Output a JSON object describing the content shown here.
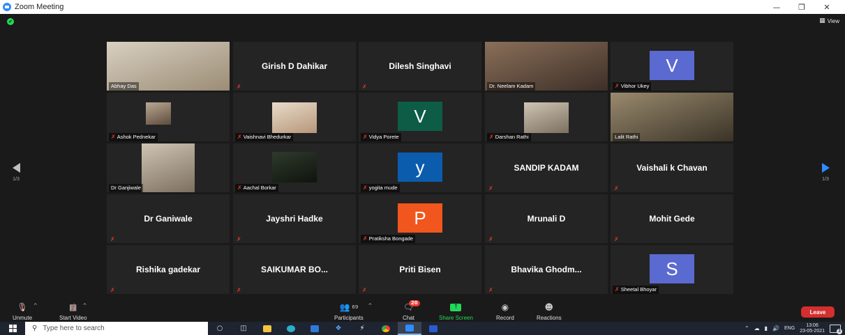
{
  "window": {
    "title": "Zoom Meeting",
    "minimize": "—",
    "restore": "❐",
    "close": "✕"
  },
  "topbar": {
    "view_label": "View",
    "view_icon": "grid-icon",
    "shield": "✔"
  },
  "pagination": {
    "left_page": "1/3",
    "right_page": "1/3"
  },
  "tiles": [
    {
      "name": "Abhay Das",
      "video": true
    },
    {
      "name": "Girish D Dahikar",
      "muted": true
    },
    {
      "name": "Dilesh Singhavi",
      "muted": true
    },
    {
      "name": "Dr. Neelam Kadam",
      "video": true,
      "active_speaker": true
    },
    {
      "name": "Vibhor Ukey",
      "initial": "V",
      "color": "#5a6ad0",
      "muted": true
    },
    {
      "name": "Ashok Pednekar",
      "video": true,
      "muted": true
    },
    {
      "name": "Vaishnavi Bhedurkar",
      "video": true,
      "muted": true
    },
    {
      "name": "Vidya Porete",
      "initial": "V",
      "color": "#0d5c46",
      "muted": true
    },
    {
      "name": "Darshan Rathi",
      "video": true,
      "muted": true
    },
    {
      "name": "Lalit Rathi",
      "video": true
    },
    {
      "name": "Dr Ganjiwale",
      "video": true
    },
    {
      "name": "Aachal Borkar",
      "video": true,
      "muted": true
    },
    {
      "name": "yogita mude",
      "initial": "y",
      "color": "#0b5cad",
      "muted": true
    },
    {
      "name": "SANDIP KADAM",
      "muted": true
    },
    {
      "name": "Vaishali k Chavan",
      "muted": true
    },
    {
      "name": "Dr Ganiwale",
      "muted": true
    },
    {
      "name": "Jayshri Hadke",
      "muted": true
    },
    {
      "name": "Pratiksha Bongade",
      "initial": "P",
      "color": "#f0561d",
      "muted": true
    },
    {
      "name": "Mrunali D",
      "muted": true
    },
    {
      "name": "Mohit Gede",
      "muted": true
    },
    {
      "name": "Rishika gadekar",
      "muted": true
    },
    {
      "name": "SAIKUMAR BO...",
      "muted": true
    },
    {
      "name": "Priti Bisen",
      "muted": true
    },
    {
      "name": "Bhavika Ghodm...",
      "muted": true
    },
    {
      "name": "Sheetal Bhoyar",
      "initial": "S",
      "color": "#5a6ad0",
      "muted": true
    }
  ],
  "toolbar": {
    "unmute": "Unmute",
    "start_video": "Start Video",
    "participants": "Participants",
    "participants_count": "69",
    "chat": "Chat",
    "chat_badge": "20",
    "share_screen": "Share Screen",
    "record": "Record",
    "reactions": "Reactions",
    "leave": "Leave",
    "caret": "^"
  },
  "taskbar": {
    "search_placeholder": "Type here to search",
    "language": "ENG",
    "time": "13:06",
    "date": "23-05-2021",
    "notification_count": "3"
  },
  "colors": {
    "accent": "#2d8cff",
    "active_speaker": "#f1ee4c",
    "share_green": "#23d959",
    "leave_red": "#d32f2f"
  }
}
